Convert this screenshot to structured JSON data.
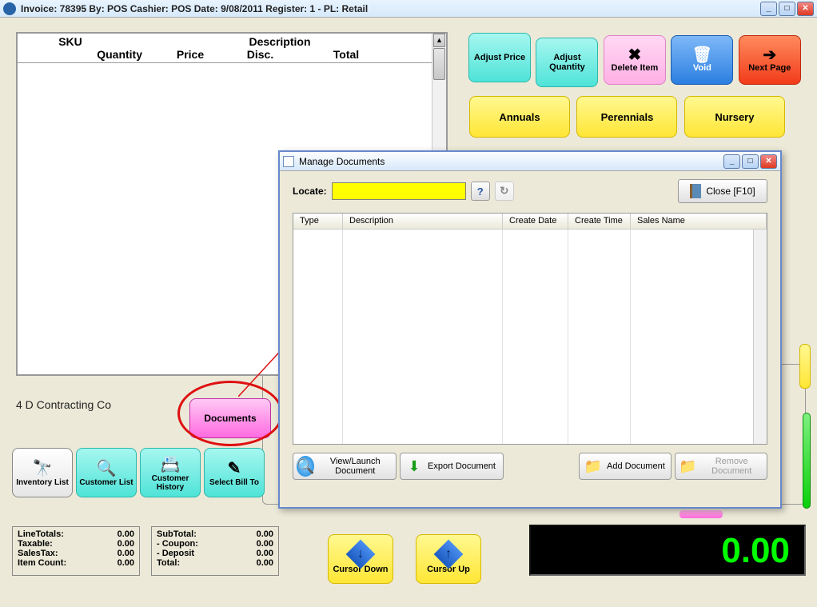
{
  "main_window": {
    "title": "Invoice: 78395  By: POS  Cashier: POS   Date:  9/08/2011  Register: 1 - PL: Retail"
  },
  "line_items": {
    "headers": {
      "sku": "SKU",
      "description": "Description",
      "quantity": "Quantity",
      "price": "Price",
      "disc": "Disc.",
      "total": "Total"
    }
  },
  "actions": {
    "adjust_price": "Adjust Price",
    "adjust_quantity": "Adjust Quantity",
    "delete_item": "Delete Item",
    "void": "Void",
    "next_page": "Next Page"
  },
  "categories": {
    "annuals": "Annuals",
    "perennials": "Perennials",
    "nursery": "Nursery"
  },
  "customer_name": "4 D Contracting Co",
  "documents_button": "Documents",
  "small_buttons": {
    "inventory_list": "Inventory List",
    "customer_list": "Customer List",
    "customer_history": "Customer History",
    "select_bill_to": "Select Bill To"
  },
  "totals_left": {
    "line_totals": {
      "label": "LineTotals:",
      "value": "0.00"
    },
    "taxable": {
      "label": "Taxable:",
      "value": "0.00"
    },
    "sales_tax": {
      "label": "SalesTax:",
      "value": "0.00"
    },
    "item_count": {
      "label": "Item Count:",
      "value": "0.00"
    }
  },
  "totals_right": {
    "subtotal": {
      "label": "SubTotal:",
      "value": "0.00"
    },
    "coupon": {
      "label": "- Coupon:",
      "value": "0.00"
    },
    "deposit": {
      "label": "- Deposit",
      "value": "0.00"
    },
    "total": {
      "label": "Total:",
      "value": "0.00"
    }
  },
  "cursor": {
    "down": "Cursor Down",
    "up": "Cursor Up"
  },
  "grand_total": "0.00",
  "dialog": {
    "title": "Manage Documents",
    "locate_label": "Locate:",
    "close_label": "Close [F10]",
    "grid_headers": {
      "type": "Type",
      "description": "Description",
      "create_date": "Create Date",
      "create_time": "Create Time",
      "sales_name": "Sales Name"
    },
    "buttons": {
      "view_launch": "View/Launch Document",
      "export": "Export Document",
      "add": "Add Document",
      "remove": "Remove Document"
    }
  }
}
